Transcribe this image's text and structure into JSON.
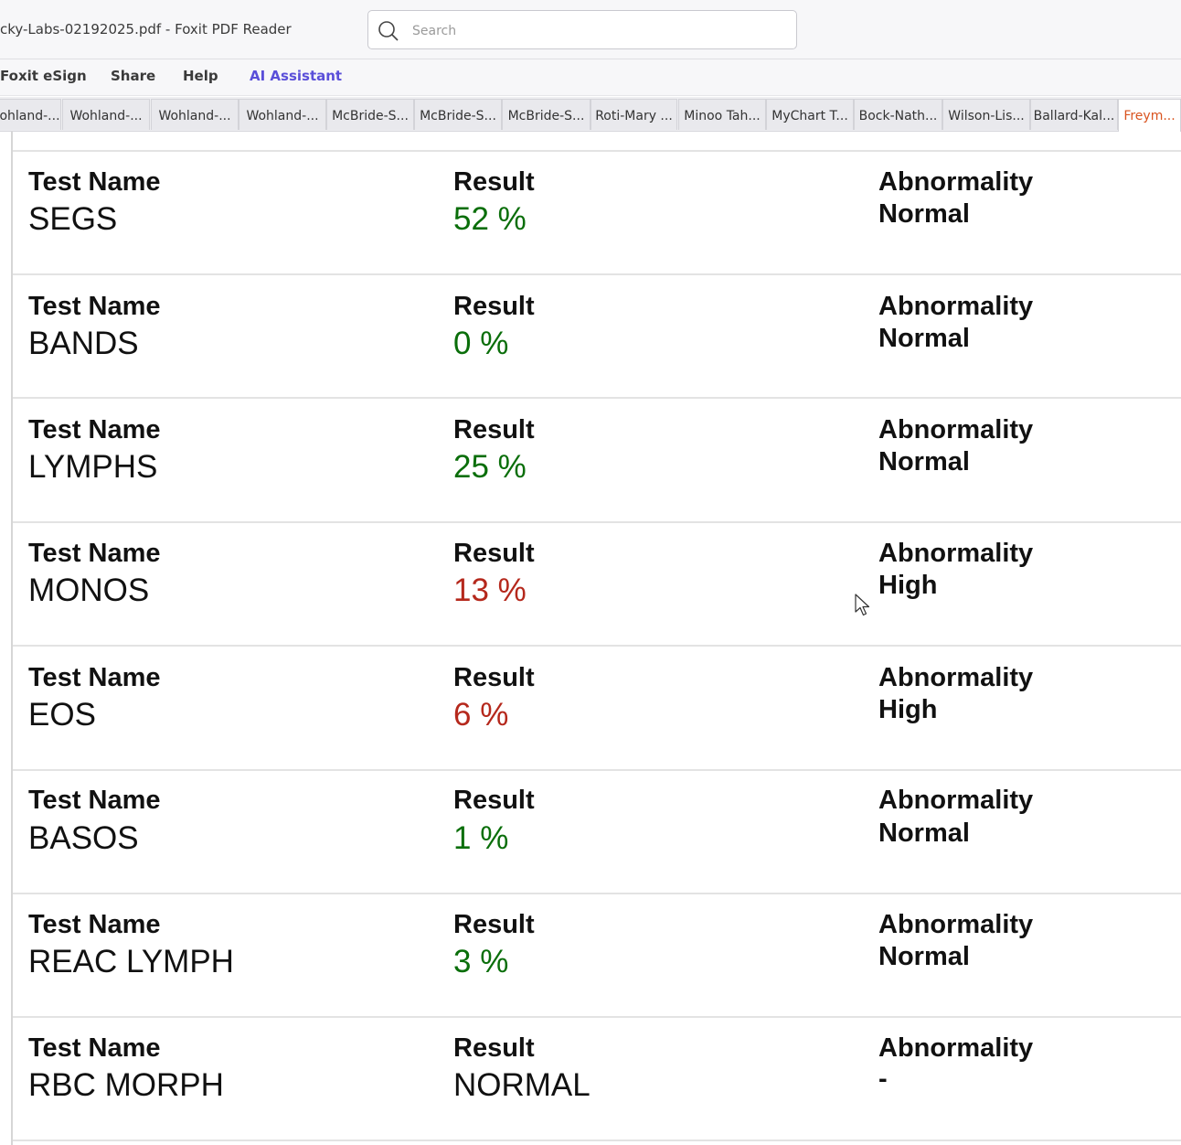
{
  "window": {
    "title": "cky-Labs-02192025.pdf - Foxit PDF Reader"
  },
  "search": {
    "placeholder": "Search"
  },
  "menu": [
    "Foxit eSign",
    "Share",
    "Help",
    "AI Assistant"
  ],
  "tabs": [
    "ohland-...",
    "Wohland-...",
    "Wohland-...",
    "Wohland-...",
    "McBride-S...",
    "McBride-S...",
    "McBride-S...",
    "Roti-Mary ...",
    "Minoo Tah...",
    "MyChart T...",
    "Bock-Nath...",
    "Wilson-Lis...",
    "Ballard-Kal...",
    "Freym..."
  ],
  "active_tab_index": 13,
  "labels": {
    "test_name": "Test Name",
    "result": "Result",
    "abnormality": "Abnormality"
  },
  "results": [
    {
      "test": "SEGS",
      "result": "52 %",
      "abnormality": "Normal",
      "status": "normal"
    },
    {
      "test": "BANDS",
      "result": "0 %",
      "abnormality": "Normal",
      "status": "normal"
    },
    {
      "test": "LYMPHS",
      "result": "25 %",
      "abnormality": "Normal",
      "status": "normal"
    },
    {
      "test": "MONOS",
      "result": "13 %",
      "abnormality": "High",
      "status": "high"
    },
    {
      "test": "EOS",
      "result": "6 %",
      "abnormality": "High",
      "status": "high"
    },
    {
      "test": "BASOS",
      "result": "1 %",
      "abnormality": "Normal",
      "status": "normal"
    },
    {
      "test": "REAC LYMPH",
      "result": "3 %",
      "abnormality": "Normal",
      "status": "normal"
    },
    {
      "test": "RBC MORPH",
      "result": "NORMAL",
      "abnormality": "-",
      "status": "plain"
    }
  ],
  "colors": {
    "normal": "#0a6e0a",
    "high": "#b5281c",
    "ai_assistant": "#5a4fd9",
    "active_tab": "#d9531e"
  }
}
